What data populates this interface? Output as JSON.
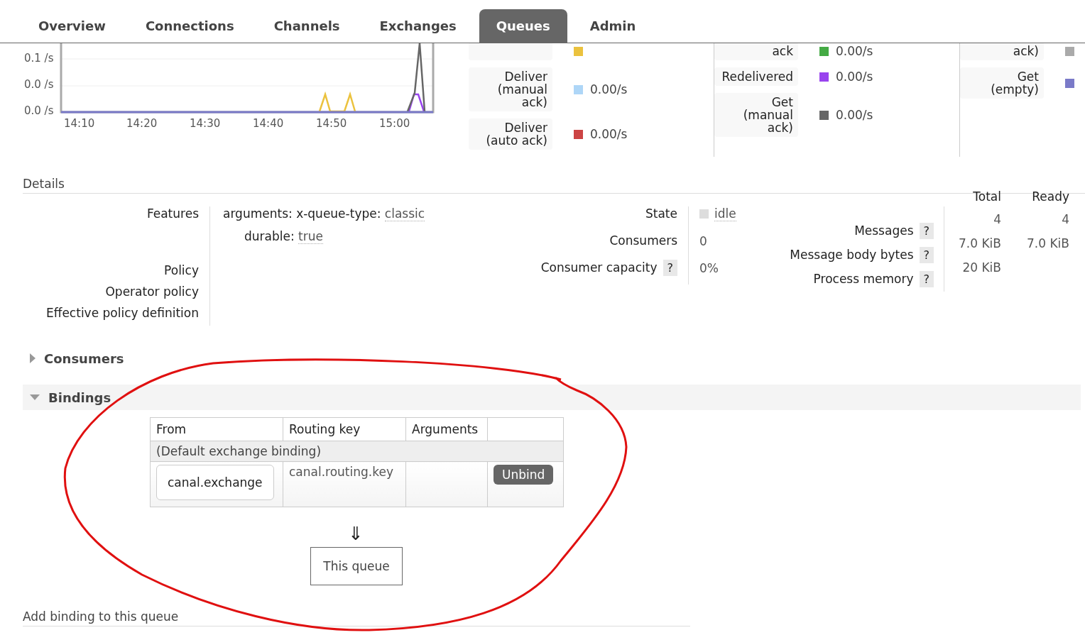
{
  "tabs": [
    {
      "label": "Overview",
      "selected": false
    },
    {
      "label": "Connections",
      "selected": false
    },
    {
      "label": "Channels",
      "selected": false
    },
    {
      "label": "Exchanges",
      "selected": false
    },
    {
      "label": "Queues",
      "selected": true
    },
    {
      "label": "Admin",
      "selected": false
    }
  ],
  "chart": {
    "y_labels": [
      "0.1 /s",
      "0.0 /s",
      "0.0 /s"
    ],
    "x_labels": [
      "14:10",
      "14:20",
      "14:30",
      "14:40",
      "14:50",
      "15:00"
    ]
  },
  "rate_columns": [
    {
      "items": [
        {
          "color": "#ebc23e"
        },
        {
          "label": "Deliver\n(manual\nack)",
          "color": "#aed6f7",
          "rate": "0.00/s"
        },
        {
          "label": "Deliver\n(auto ack)",
          "color": "#cc4444",
          "rate": "0.00/s"
        }
      ]
    },
    {
      "items": [
        {
          "label": "ack",
          "color": "#44aa44",
          "rate": "0.00/s"
        },
        {
          "label": "Redelivered",
          "color": "#9944ee",
          "rate": "0.00/s"
        },
        {
          "label": "Get\n(manual\nack)",
          "color": "#666666",
          "rate": "0.00/s"
        }
      ]
    },
    {
      "items": [
        {
          "label": "ack)",
          "color": "#aaaaaa"
        },
        {
          "label": "Get\n(empty)",
          "color": "#7a7ac8"
        }
      ]
    }
  ],
  "details": {
    "title": "Details",
    "features": {
      "label": "Features",
      "arguments_label": "arguments:",
      "argument_key": "x-queue-type:",
      "argument_value": "classic",
      "durable_label": "durable:",
      "durable_value": "true"
    },
    "policies": [
      "Policy",
      "Operator policy",
      "Effective policy definition"
    ],
    "state": {
      "label": "State",
      "value": "idle"
    },
    "consumers": {
      "label": "Consumers",
      "value": "0"
    },
    "capacity": {
      "label": "Consumer capacity",
      "help": "?",
      "value": "0%"
    },
    "stats_columns": [
      "Total",
      "Ready"
    ],
    "stats": [
      {
        "label": "Messages",
        "help": "?",
        "values": [
          "4",
          "4"
        ]
      },
      {
        "label": "Message body bytes",
        "help": "?",
        "values": [
          "7.0 KiB",
          "7.0 KiB"
        ]
      },
      {
        "label": "Process memory",
        "help": "?",
        "values": [
          "20 KiB"
        ]
      }
    ]
  },
  "sections": [
    {
      "title": "Consumers",
      "expanded": false
    },
    {
      "title": "Bindings",
      "expanded": true
    }
  ],
  "bindings": {
    "columns": [
      "From",
      "Routing key",
      "Arguments"
    ],
    "group": "(Default exchange binding)",
    "rows": [
      {
        "from": "canal.exchange",
        "routing_key": "canal.routing.key",
        "action": "Unbind"
      }
    ],
    "arrow": "⇓",
    "target": "This queue"
  },
  "add_binding": "Add binding to this queue"
}
